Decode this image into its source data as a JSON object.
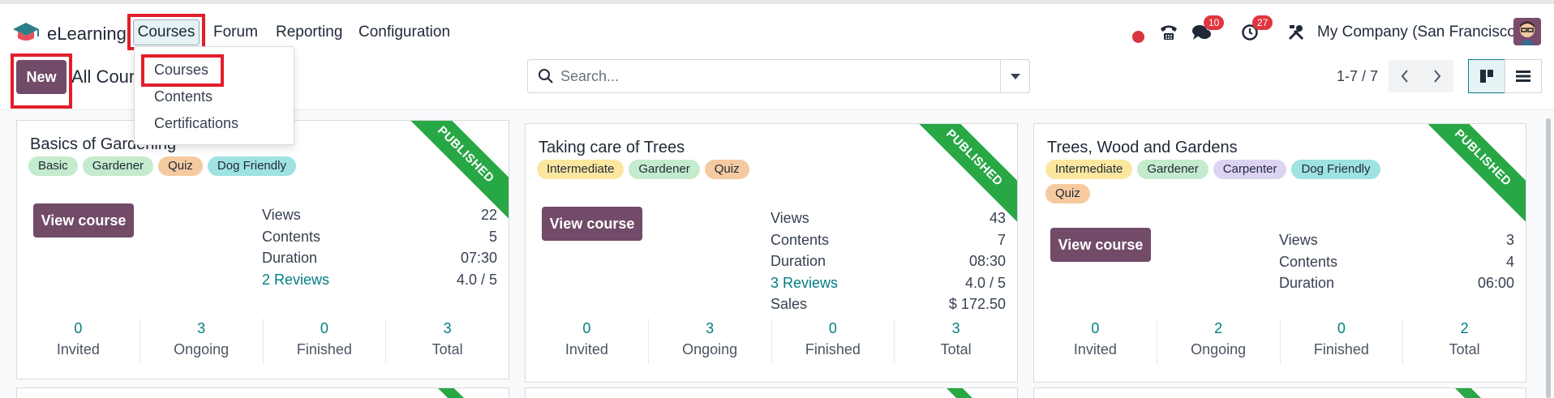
{
  "app": {
    "name": "eLearning",
    "logo_icon": "graduation-cap-icon"
  },
  "menu": {
    "items": [
      {
        "label": "Courses",
        "active": true
      },
      {
        "label": "Forum"
      },
      {
        "label": "Reporting"
      },
      {
        "label": "Configuration"
      }
    ],
    "dropdown": [
      "Courses",
      "Contents",
      "Certifications"
    ]
  },
  "systray": {
    "status_dot_color": "#d9363e",
    "phone_icon": "phone-icon",
    "messages_icon": "chat-icon",
    "messages_badge": "10",
    "activities_icon": "clock-icon",
    "activities_badge": "27",
    "debug_icon": "tools-icon",
    "company": "My Company (San Francisco)",
    "avatar_icon": "user-avatar-icon"
  },
  "control": {
    "new_label": "New",
    "breadcrumb": "All Courses",
    "search_placeholder": "Search...",
    "pager": "1-7 / 7"
  },
  "colors": {
    "primary": "#714b67",
    "accent": "#017e84",
    "ribbon": "#28a745",
    "highlight": "#e21e2a"
  },
  "cards": [
    {
      "title": "Basics of Gardening",
      "ribbon": "PUBLISHED",
      "tags": [
        {
          "label": "Basic",
          "color": "#c4ebcd"
        },
        {
          "label": "Gardener",
          "color": "#c4ebcd"
        },
        {
          "label": "Quiz",
          "color": "#f5caa0"
        },
        {
          "label": "Dog Friendly",
          "color": "#9fe2e2"
        }
      ],
      "button": "View course",
      "stats": [
        {
          "label": "Views",
          "value": "22"
        },
        {
          "label": "Contents",
          "value": "5"
        },
        {
          "label": "Duration",
          "value": "07:30"
        },
        {
          "label": "2 Reviews",
          "value": "4.0 / 5",
          "link": true
        }
      ],
      "counts": [
        {
          "num": "0",
          "label": "Invited"
        },
        {
          "num": "3",
          "label": "Ongoing"
        },
        {
          "num": "0",
          "label": "Finished"
        },
        {
          "num": "3",
          "label": "Total"
        }
      ]
    },
    {
      "title": "Taking care of Trees",
      "ribbon": "PUBLISHED",
      "tags": [
        {
          "label": "Intermediate",
          "color": "#fbe7a0"
        },
        {
          "label": "Gardener",
          "color": "#c4ebcd"
        },
        {
          "label": "Quiz",
          "color": "#f5caa0"
        }
      ],
      "button": "View course",
      "stats": [
        {
          "label": "Views",
          "value": "43"
        },
        {
          "label": "Contents",
          "value": "7"
        },
        {
          "label": "Duration",
          "value": "08:30"
        },
        {
          "label": "3 Reviews",
          "value": "4.0 / 5",
          "link": true
        },
        {
          "label": "Sales",
          "value": "$ 172.50"
        }
      ],
      "counts": [
        {
          "num": "0",
          "label": "Invited"
        },
        {
          "num": "3",
          "label": "Ongoing"
        },
        {
          "num": "0",
          "label": "Finished"
        },
        {
          "num": "3",
          "label": "Total"
        }
      ]
    },
    {
      "title": "Trees, Wood and Gardens",
      "ribbon": "PUBLISHED",
      "tags": [
        {
          "label": "Intermediate",
          "color": "#fbe7a0"
        },
        {
          "label": "Gardener",
          "color": "#c4ebcd"
        },
        {
          "label": "Carpenter",
          "color": "#dcd3f2"
        },
        {
          "label": "Dog Friendly",
          "color": "#9fe2e2"
        },
        {
          "label": "Quiz",
          "color": "#f5caa0"
        }
      ],
      "button": "View course",
      "stats": [
        {
          "label": "Views",
          "value": "3"
        },
        {
          "label": "Contents",
          "value": "4"
        },
        {
          "label": "Duration",
          "value": "06:00"
        }
      ],
      "counts": [
        {
          "num": "0",
          "label": "Invited"
        },
        {
          "num": "2",
          "label": "Ongoing"
        },
        {
          "num": "0",
          "label": "Finished"
        },
        {
          "num": "2",
          "label": "Total"
        }
      ]
    }
  ]
}
